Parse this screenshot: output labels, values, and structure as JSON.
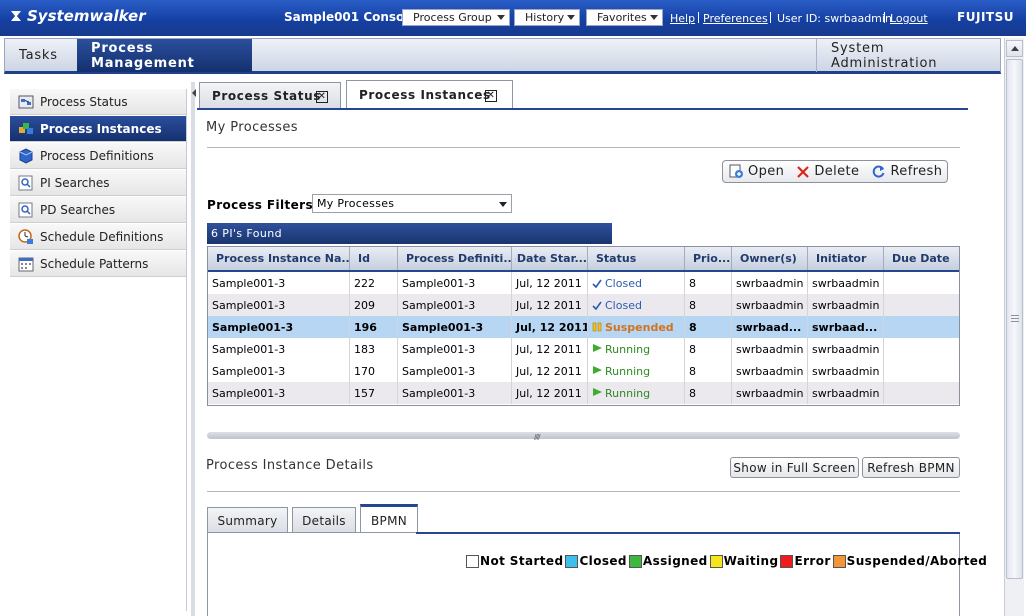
{
  "topbar": {
    "logo": "Systemwalker",
    "console_title": "Sample001 Console",
    "process_group": "Process Group",
    "history": "History",
    "favorites": "Favorites",
    "help": "Help",
    "preferences": "Preferences",
    "user_id": "User ID: swrbaadmin",
    "logout": "Logout",
    "brand": "FUJITSU",
    "bar_color": "#1a46a8"
  },
  "mainnav": {
    "tasks": "Tasks",
    "process_management": "Process Management",
    "system_administration": "System Administration"
  },
  "sidebar": {
    "items": [
      {
        "label": "Process Status",
        "icon": "process-status-icon"
      },
      {
        "label": "Process Instances",
        "icon": "process-instances-icon"
      },
      {
        "label": "Process Definitions",
        "icon": "process-definitions-icon"
      },
      {
        "label": "PI Searches",
        "icon": "pi-search-icon"
      },
      {
        "label": "PD Searches",
        "icon": "pd-search-icon"
      },
      {
        "label": "Schedule Definitions",
        "icon": "schedule-definitions-icon"
      },
      {
        "label": "Schedule Patterns",
        "icon": "schedule-patterns-icon"
      }
    ]
  },
  "content_tabs": {
    "process_status": "Process Status",
    "process_instances": "Process Instances"
  },
  "my_processes": {
    "title": "My Processes",
    "toolbar": {
      "open": "Open",
      "delete": "Delete",
      "refresh": "Refresh"
    },
    "filter_label": "Process Filters:",
    "filter_value": "My Processes",
    "found": "6 PI's Found",
    "columns": [
      "Process Instance Na...",
      "Id",
      "Process Definiti...",
      "Date Star...",
      "Status",
      "Prio...",
      "Owner(s)",
      "Initiator",
      "Due Date"
    ],
    "rows": [
      {
        "name": "Sample001-3",
        "id": "222",
        "definition": "Sample001-3",
        "date": "Jul, 12 2011",
        "status": "Closed",
        "priority": "8",
        "owner": "swrbaadmin",
        "initiator": "swrbaadmin",
        "due": ""
      },
      {
        "name": "Sample001-3",
        "id": "209",
        "definition": "Sample001-3",
        "date": "Jul, 12 2011",
        "status": "Closed",
        "priority": "8",
        "owner": "swrbaadmin",
        "initiator": "swrbaadmin",
        "due": ""
      },
      {
        "name": "Sample001-3",
        "id": "196",
        "definition": "Sample001-3",
        "date": "Jul, 12 2011",
        "status": "Suspended",
        "priority": "8",
        "owner": "swrbaad...",
        "initiator": "swrbaad...",
        "due": ""
      },
      {
        "name": "Sample001-3",
        "id": "183",
        "definition": "Sample001-3",
        "date": "Jul, 12 2011",
        "status": "Running",
        "priority": "8",
        "owner": "swrbaadmin",
        "initiator": "swrbaadmin",
        "due": ""
      },
      {
        "name": "Sample001-3",
        "id": "170",
        "definition": "Sample001-3",
        "date": "Jul, 12 2011",
        "status": "Running",
        "priority": "8",
        "owner": "swrbaadmin",
        "initiator": "swrbaadmin",
        "due": ""
      },
      {
        "name": "Sample001-3",
        "id": "157",
        "definition": "Sample001-3",
        "date": "Jul, 12 2011",
        "status": "Running",
        "priority": "8",
        "owner": "swrbaadmin",
        "initiator": "swrbaadmin",
        "due": ""
      }
    ]
  },
  "details": {
    "title": "Process Instance Details",
    "full_screen": "Show in Full Screen",
    "refresh_bpmn": "Refresh BPMN",
    "tabs": {
      "summary": "Summary",
      "details": "Details",
      "bpmn": "BPMN"
    },
    "legend": [
      {
        "label": "Not Started",
        "color": "#ffffff"
      },
      {
        "label": "Closed",
        "color": "#3cc0ea"
      },
      {
        "label": "Assigned",
        "color": "#3cb83c"
      },
      {
        "label": "Waiting",
        "color": "#f5e51d"
      },
      {
        "label": "Error",
        "color": "#ee1c1c"
      },
      {
        "label": "Suspended/Aborted",
        "color": "#f5953a"
      }
    ]
  }
}
